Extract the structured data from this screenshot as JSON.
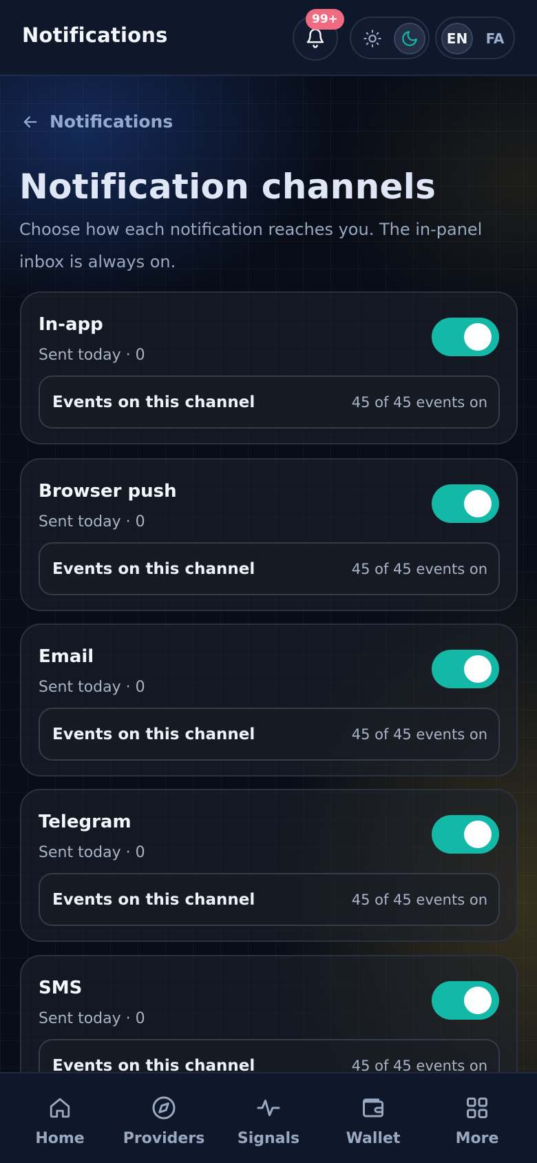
{
  "header": {
    "title": "Notifications",
    "notification_count": "99+",
    "theme_options": [
      "light",
      "dark"
    ],
    "theme_selected": "dark",
    "lang_en": "EN",
    "lang_fa": "FA",
    "lang_selected": "EN",
    "accent_color": "#14b8a6",
    "badge_color": "#ef6b82"
  },
  "breadcrumb": {
    "back_icon": "arrow-left-icon",
    "label": "Notifications"
  },
  "page": {
    "title": "Notification channels",
    "subtitle": "Choose how each notification reaches you. The in-panel inbox is always on."
  },
  "channels": [
    {
      "name": "In-app",
      "sent": "Sent today · 0",
      "enabled": true,
      "events_label": "Events on this channel",
      "events_count": "45 of 45 events on"
    },
    {
      "name": "Browser push",
      "sent": "Sent today · 0",
      "enabled": true,
      "events_label": "Events on this channel",
      "events_count": "45 of 45 events on"
    },
    {
      "name": "Email",
      "sent": "Sent today · 0",
      "enabled": true,
      "events_label": "Events on this channel",
      "events_count": "45 of 45 events on"
    },
    {
      "name": "Telegram",
      "sent": "Sent today · 0",
      "enabled": true,
      "events_label": "Events on this channel",
      "events_count": "45 of 45 events on"
    },
    {
      "name": "SMS",
      "sent": "Sent today · 0",
      "enabled": true,
      "events_label": "Events on this channel",
      "events_count": "45 of 45 events on"
    }
  ],
  "nav": [
    {
      "label": "Home",
      "icon": "home-icon"
    },
    {
      "label": "Providers",
      "icon": "compass-icon"
    },
    {
      "label": "Signals",
      "icon": "activity-icon"
    },
    {
      "label": "Wallet",
      "icon": "wallet-icon"
    },
    {
      "label": "More",
      "icon": "grid-icon"
    }
  ]
}
